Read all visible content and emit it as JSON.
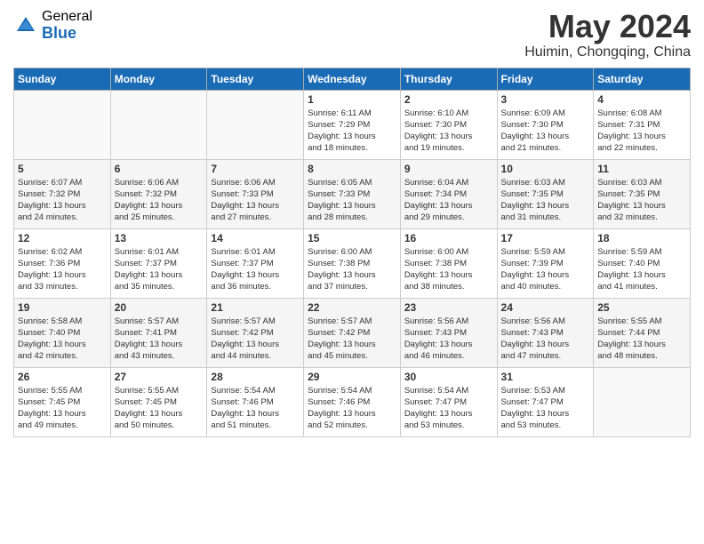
{
  "header": {
    "logo_general": "General",
    "logo_blue": "Blue",
    "month": "May 2024",
    "location": "Huimin, Chongqing, China"
  },
  "days_of_week": [
    "Sunday",
    "Monday",
    "Tuesday",
    "Wednesday",
    "Thursday",
    "Friday",
    "Saturday"
  ],
  "weeks": [
    [
      {
        "day": "",
        "info": ""
      },
      {
        "day": "",
        "info": ""
      },
      {
        "day": "",
        "info": ""
      },
      {
        "day": "1",
        "info": "Sunrise: 6:11 AM\nSunset: 7:29 PM\nDaylight: 13 hours\nand 18 minutes."
      },
      {
        "day": "2",
        "info": "Sunrise: 6:10 AM\nSunset: 7:30 PM\nDaylight: 13 hours\nand 19 minutes."
      },
      {
        "day": "3",
        "info": "Sunrise: 6:09 AM\nSunset: 7:30 PM\nDaylight: 13 hours\nand 21 minutes."
      },
      {
        "day": "4",
        "info": "Sunrise: 6:08 AM\nSunset: 7:31 PM\nDaylight: 13 hours\nand 22 minutes."
      }
    ],
    [
      {
        "day": "5",
        "info": "Sunrise: 6:07 AM\nSunset: 7:32 PM\nDaylight: 13 hours\nand 24 minutes."
      },
      {
        "day": "6",
        "info": "Sunrise: 6:06 AM\nSunset: 7:32 PM\nDaylight: 13 hours\nand 25 minutes."
      },
      {
        "day": "7",
        "info": "Sunrise: 6:06 AM\nSunset: 7:33 PM\nDaylight: 13 hours\nand 27 minutes."
      },
      {
        "day": "8",
        "info": "Sunrise: 6:05 AM\nSunset: 7:33 PM\nDaylight: 13 hours\nand 28 minutes."
      },
      {
        "day": "9",
        "info": "Sunrise: 6:04 AM\nSunset: 7:34 PM\nDaylight: 13 hours\nand 29 minutes."
      },
      {
        "day": "10",
        "info": "Sunrise: 6:03 AM\nSunset: 7:35 PM\nDaylight: 13 hours\nand 31 minutes."
      },
      {
        "day": "11",
        "info": "Sunrise: 6:03 AM\nSunset: 7:35 PM\nDaylight: 13 hours\nand 32 minutes."
      }
    ],
    [
      {
        "day": "12",
        "info": "Sunrise: 6:02 AM\nSunset: 7:36 PM\nDaylight: 13 hours\nand 33 minutes."
      },
      {
        "day": "13",
        "info": "Sunrise: 6:01 AM\nSunset: 7:37 PM\nDaylight: 13 hours\nand 35 minutes."
      },
      {
        "day": "14",
        "info": "Sunrise: 6:01 AM\nSunset: 7:37 PM\nDaylight: 13 hours\nand 36 minutes."
      },
      {
        "day": "15",
        "info": "Sunrise: 6:00 AM\nSunset: 7:38 PM\nDaylight: 13 hours\nand 37 minutes."
      },
      {
        "day": "16",
        "info": "Sunrise: 6:00 AM\nSunset: 7:38 PM\nDaylight: 13 hours\nand 38 minutes."
      },
      {
        "day": "17",
        "info": "Sunrise: 5:59 AM\nSunset: 7:39 PM\nDaylight: 13 hours\nand 40 minutes."
      },
      {
        "day": "18",
        "info": "Sunrise: 5:59 AM\nSunset: 7:40 PM\nDaylight: 13 hours\nand 41 minutes."
      }
    ],
    [
      {
        "day": "19",
        "info": "Sunrise: 5:58 AM\nSunset: 7:40 PM\nDaylight: 13 hours\nand 42 minutes."
      },
      {
        "day": "20",
        "info": "Sunrise: 5:57 AM\nSunset: 7:41 PM\nDaylight: 13 hours\nand 43 minutes."
      },
      {
        "day": "21",
        "info": "Sunrise: 5:57 AM\nSunset: 7:42 PM\nDaylight: 13 hours\nand 44 minutes."
      },
      {
        "day": "22",
        "info": "Sunrise: 5:57 AM\nSunset: 7:42 PM\nDaylight: 13 hours\nand 45 minutes."
      },
      {
        "day": "23",
        "info": "Sunrise: 5:56 AM\nSunset: 7:43 PM\nDaylight: 13 hours\nand 46 minutes."
      },
      {
        "day": "24",
        "info": "Sunrise: 5:56 AM\nSunset: 7:43 PM\nDaylight: 13 hours\nand 47 minutes."
      },
      {
        "day": "25",
        "info": "Sunrise: 5:55 AM\nSunset: 7:44 PM\nDaylight: 13 hours\nand 48 minutes."
      }
    ],
    [
      {
        "day": "26",
        "info": "Sunrise: 5:55 AM\nSunset: 7:45 PM\nDaylight: 13 hours\nand 49 minutes."
      },
      {
        "day": "27",
        "info": "Sunrise: 5:55 AM\nSunset: 7:45 PM\nDaylight: 13 hours\nand 50 minutes."
      },
      {
        "day": "28",
        "info": "Sunrise: 5:54 AM\nSunset: 7:46 PM\nDaylight: 13 hours\nand 51 minutes."
      },
      {
        "day": "29",
        "info": "Sunrise: 5:54 AM\nSunset: 7:46 PM\nDaylight: 13 hours\nand 52 minutes."
      },
      {
        "day": "30",
        "info": "Sunrise: 5:54 AM\nSunset: 7:47 PM\nDaylight: 13 hours\nand 53 minutes."
      },
      {
        "day": "31",
        "info": "Sunrise: 5:53 AM\nSunset: 7:47 PM\nDaylight: 13 hours\nand 53 minutes."
      },
      {
        "day": "",
        "info": ""
      }
    ]
  ]
}
